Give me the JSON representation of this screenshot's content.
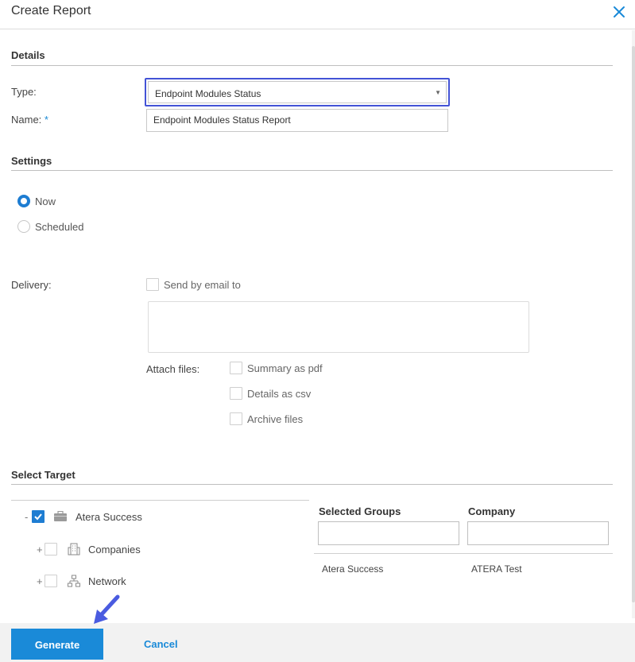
{
  "dialog": {
    "title": "Create Report",
    "close_icon": "close-icon"
  },
  "details": {
    "heading": "Details",
    "type_label": "Type:",
    "type_value": "Endpoint Modules Status",
    "name_label": "Name:",
    "name_required": "*",
    "name_value": "Endpoint Modules Status Report"
  },
  "settings": {
    "heading": "Settings",
    "options": [
      {
        "label": "Now",
        "selected": true
      },
      {
        "label": "Scheduled",
        "selected": false
      }
    ]
  },
  "delivery": {
    "label": "Delivery:",
    "send_email_label": "Send by email to",
    "email_value": "",
    "attach_label": "Attach files:",
    "attach_options": [
      {
        "label": "Summary as pdf",
        "checked": false
      },
      {
        "label": "Details as csv",
        "checked": false
      },
      {
        "label": "Archive files",
        "checked": false
      }
    ]
  },
  "target": {
    "heading": "Select Target",
    "tree": [
      {
        "toggle": "-",
        "label": "Atera Success",
        "checked": true,
        "icon": "briefcase-icon"
      },
      {
        "toggle": "+",
        "label": "Companies",
        "checked": false,
        "icon": "building-icon"
      },
      {
        "toggle": "+",
        "label": "Network",
        "checked": false,
        "icon": "network-icon"
      }
    ],
    "columns": [
      "Selected Groups",
      "Company"
    ],
    "rows": [
      {
        "group": "Atera Success",
        "company": "ATERA Test"
      }
    ]
  },
  "footer": {
    "generate_label": "Generate",
    "cancel_label": "Cancel"
  },
  "colors": {
    "accent": "#1a8ad8",
    "highlight": "#4353d6",
    "pointer": "#4a5be0"
  }
}
